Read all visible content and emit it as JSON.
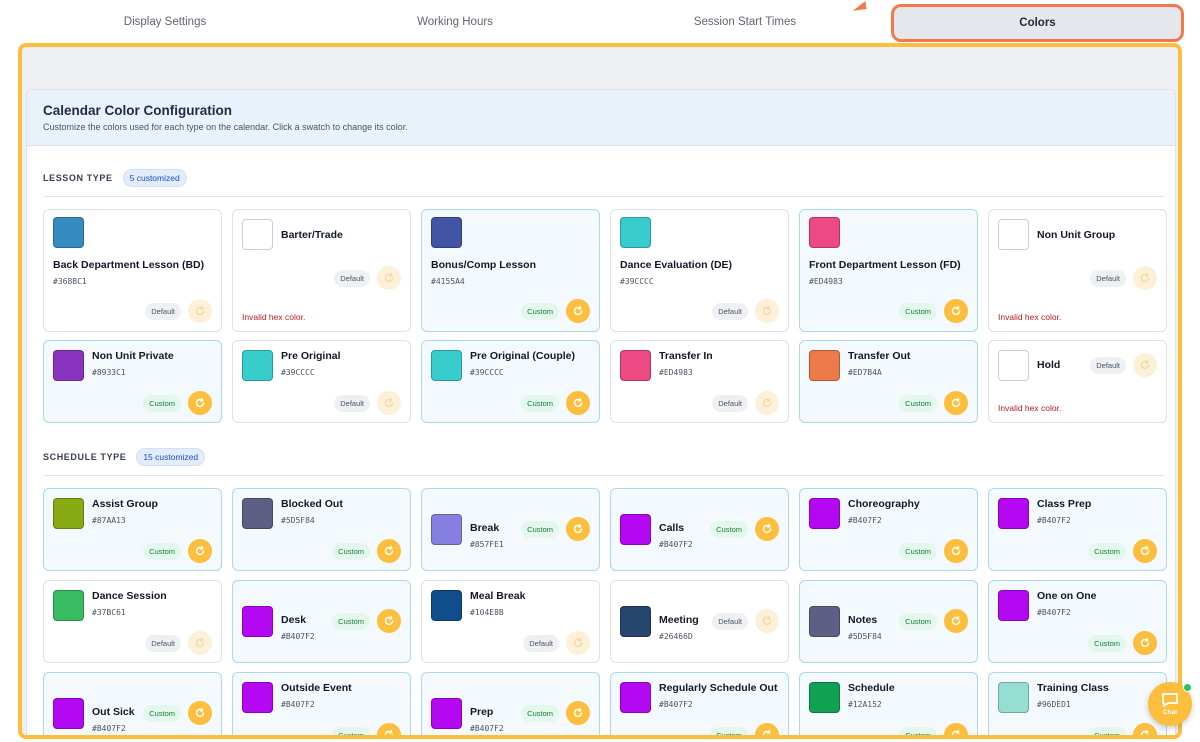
{
  "tabs": [
    {
      "label": "Display Settings"
    },
    {
      "label": "Working Hours"
    },
    {
      "label": "Session Start Times"
    },
    {
      "label": "Colors"
    }
  ],
  "card": {
    "title": "Calendar Color Configuration",
    "subtitle": "Customize the colors used for each type on the calendar. Click a swatch to change its color."
  },
  "sections": [
    {
      "label": "LESSON TYPE",
      "badge": "5 customized",
      "items": [
        {
          "name": "Back Department Lesson (BD)",
          "hex": "#368BC1",
          "color": "#368BC1",
          "status": "Default",
          "layout": "tall"
        },
        {
          "name": "Barter/Trade",
          "hex": "",
          "color": "",
          "status": "Default",
          "invalid": "Invalid hex color.",
          "layout": "tall"
        },
        {
          "name": "Bonus/Comp Lesson",
          "hex": "#4155A4",
          "color": "#4155A4",
          "status": "Custom",
          "layout": "tall"
        },
        {
          "name": "Dance Evaluation (DE)",
          "hex": "#39CCCC",
          "color": "#39CCCC",
          "status": "Default",
          "layout": "tall"
        },
        {
          "name": "Front Department Lesson (FD)",
          "hex": "#ED4983",
          "color": "#ED4983",
          "status": "Custom",
          "layout": "tall"
        },
        {
          "name": "Non Unit Group",
          "hex": "",
          "color": "",
          "status": "Default",
          "invalid": "Invalid hex color.",
          "layout": "tall"
        },
        {
          "name": "Non Unit Private",
          "hex": "#8933C1",
          "color": "#8933C1",
          "status": "Custom"
        },
        {
          "name": "Pre Original",
          "hex": "#39CCCC",
          "color": "#39CCCC",
          "status": "Default"
        },
        {
          "name": "Pre Original (Couple)",
          "hex": "#39CCCC",
          "color": "#39CCCC",
          "status": "Custom"
        },
        {
          "name": "Transfer In",
          "hex": "#ED4983",
          "color": "#ED4983",
          "status": "Default"
        },
        {
          "name": "Transfer Out",
          "hex": "#ED7B4A",
          "color": "#ED7B4A",
          "status": "Custom"
        },
        {
          "name": "Hold",
          "hex": "",
          "color": "",
          "status": "Default",
          "invalid": "Invalid hex color."
        }
      ]
    },
    {
      "label": "SCHEDULE TYPE",
      "badge": "15 customized",
      "items": [
        {
          "name": "Assist Group",
          "hex": "#87AA13",
          "color": "#87AA13",
          "status": "Custom"
        },
        {
          "name": "Blocked Out",
          "hex": "#5D5F84",
          "color": "#5D5F84",
          "status": "Custom"
        },
        {
          "name": "Break",
          "hex": "#857FE1",
          "color": "#857FE1",
          "status": "Custom",
          "layout": "side"
        },
        {
          "name": "Calls",
          "hex": "#B407F2",
          "color": "#B407F2",
          "status": "Custom",
          "layout": "side"
        },
        {
          "name": "Choreography",
          "hex": "#B407F2",
          "color": "#B407F2",
          "status": "Custom"
        },
        {
          "name": "Class Prep",
          "hex": "#B407F2",
          "color": "#B407F2",
          "status": "Custom"
        },
        {
          "name": "Dance Session",
          "hex": "#37BC61",
          "color": "#37BC61",
          "status": "Default"
        },
        {
          "name": "Desk",
          "hex": "#B407F2",
          "color": "#B407F2",
          "status": "Custom",
          "layout": "side"
        },
        {
          "name": "Meal Break",
          "hex": "#104E8B",
          "color": "#104E8B",
          "status": "Default"
        },
        {
          "name": "Meeting",
          "hex": "#26466D",
          "color": "#26466D",
          "status": "Default",
          "layout": "side"
        },
        {
          "name": "Notes",
          "hex": "#5D5F84",
          "color": "#5D5F84",
          "status": "Custom",
          "layout": "side"
        },
        {
          "name": "One on One",
          "hex": "#B407F2",
          "color": "#B407F2",
          "status": "Custom"
        },
        {
          "name": "Out Sick",
          "hex": "#B407F2",
          "color": "#B407F2",
          "status": "Custom",
          "layout": "side"
        },
        {
          "name": "Outside Event",
          "hex": "#B407F2",
          "color": "#B407F2",
          "status": "Custom"
        },
        {
          "name": "Prep",
          "hex": "#B407F2",
          "color": "#B407F2",
          "status": "Custom",
          "layout": "side"
        },
        {
          "name": "Regularly Schedule Out",
          "hex": "#B407F2",
          "color": "#B407F2",
          "status": "Custom"
        },
        {
          "name": "Schedule",
          "hex": "#12A152",
          "color": "#12A152",
          "status": "Custom"
        },
        {
          "name": "Training Class",
          "hex": "#96DED1",
          "color": "#96DED1",
          "status": "Custom"
        }
      ]
    }
  ],
  "chat": {
    "label": "Chat"
  }
}
